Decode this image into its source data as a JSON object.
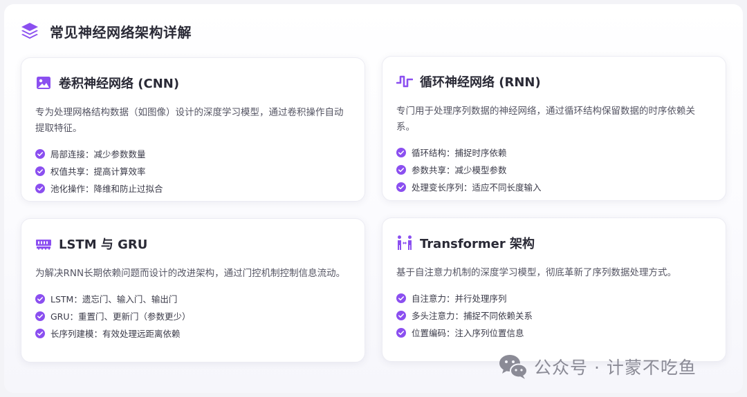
{
  "page": {
    "title": "常见神经网络架构详解",
    "icon": "layers-icon"
  },
  "colors": {
    "accent": "#8b4ff0",
    "text": "#2a2a36",
    "muted": "#555563"
  },
  "cards": [
    {
      "title": "卷积神经网络 (CNN)",
      "icon": "image-icon",
      "description": "专为处理网格结构数据（如图像）设计的深度学习模型，通过卷积操作自动提取特征。",
      "features": [
        "局部连接：减少参数数量",
        "权值共享：提高计算效率",
        "池化操作：降维和防止过拟合"
      ]
    },
    {
      "title": "循环神经网络 (RNN)",
      "icon": "wave-signal-icon",
      "description": "专门用于处理序列数据的神经网络，通过循环结构保留数据的时序依赖关系。",
      "features": [
        "循环结构：捕捉时序依赖",
        "参数共享：减少模型参数",
        "处理变长序列：适应不同长度输入"
      ]
    },
    {
      "title": "LSTM 与 GRU",
      "icon": "memory-chip-icon",
      "description": "为解决RNN长期依赖问题而设计的改进架构，通过门控机制控制信息流动。",
      "features": [
        "LSTM：遗忘门、输入门、输出门",
        "GRU：重置门、更新门（参数更少）",
        "长序列建模：有效处理远距离依赖"
      ]
    },
    {
      "title": "Transformer 架构",
      "icon": "people-arrows-icon",
      "description": "基于自注意力机制的深度学习模型，彻底革新了序列数据处理方式。",
      "features": [
        "自注意力：并行处理序列",
        "多头注意力：捕捉不同依赖关系",
        "位置编码：注入序列位置信息"
      ]
    }
  ],
  "watermark": {
    "text": "公众号 · 计蒙不吃鱼",
    "icon": "wechat-icon"
  }
}
